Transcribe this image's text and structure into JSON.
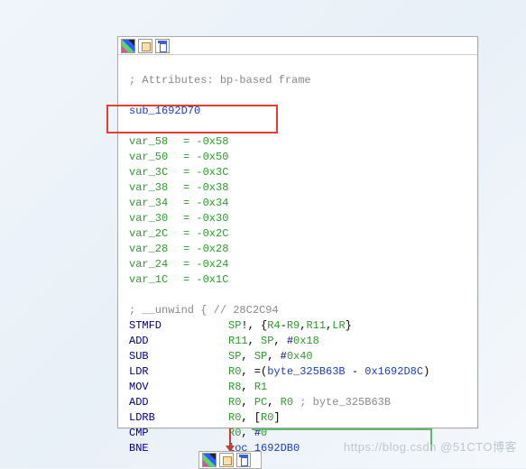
{
  "attributes_comment": "; Attributes: bp-based frame",
  "sub_name": "sub_1692D70",
  "vars": [
    {
      "name": "var_58",
      "off": "-0x58"
    },
    {
      "name": "var_50",
      "off": "-0x50"
    },
    {
      "name": "var_3C",
      "off": "-0x3C"
    },
    {
      "name": "var_38",
      "off": "-0x38"
    },
    {
      "name": "var_34",
      "off": "-0x34"
    },
    {
      "name": "var_30",
      "off": "-0x30"
    },
    {
      "name": "var_2C",
      "off": "-0x2C"
    },
    {
      "name": "var_28",
      "off": "-0x28"
    },
    {
      "name": "var_24",
      "off": "-0x24"
    },
    {
      "name": "var_1C",
      "off": "-0x1C"
    }
  ],
  "unwind_comment": "; __unwind { // 28C2C94",
  "instructions": [
    {
      "mn": "STMFD",
      "ops": "SP!, {R4-R9,R11,LR}",
      "cmt": ""
    },
    {
      "mn": "ADD",
      "ops": "R11, SP, #0x18",
      "cmt": ""
    },
    {
      "mn": "SUB",
      "ops": "SP, SP, #0x40",
      "cmt": ""
    },
    {
      "mn": "LDR",
      "ops": "R0, =(byte_325B63B - 0x1692D8C)",
      "cmt": ""
    },
    {
      "mn": "MOV",
      "ops": "R8, R1",
      "cmt": ""
    },
    {
      "mn": "ADD",
      "ops": "R0, PC, R0",
      "cmt": " ; byte_325B63B"
    },
    {
      "mn": "LDRB",
      "ops": "R0, [R0]",
      "cmt": ""
    },
    {
      "mn": "CMP",
      "ops": "R0, #0",
      "cmt": ""
    },
    {
      "mn": "BNE",
      "ops": "loc_1692DB0",
      "cmt": ""
    }
  ],
  "watermark": "https://blog.csdn  @51CTO博客",
  "icons": {
    "color": "color-palette-icon",
    "edit": "edit-comment-icon",
    "flow": "flow-group-icon"
  }
}
